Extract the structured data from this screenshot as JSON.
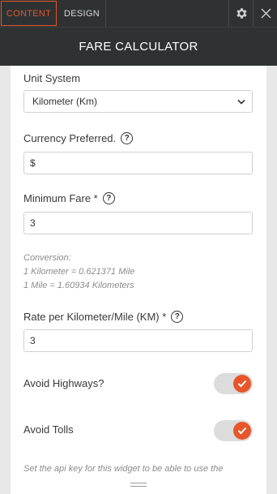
{
  "tabs": {
    "content": "CONTENT",
    "design": "DESIGN"
  },
  "header": {
    "title": "FARE CALCULATOR"
  },
  "form": {
    "unit_system": {
      "label": "Unit System",
      "value": "Kilometer (Km)"
    },
    "currency": {
      "label": "Currency Preferred.",
      "value": "$"
    },
    "minimum_fare": {
      "label": "Minimum Fare *",
      "value": "3"
    },
    "conversion": {
      "heading": "Conversion:",
      "line1": "1 Kilometer = 0.621371 Mile",
      "line2": "1 Mile = 1.60934 Kilometers"
    },
    "rate": {
      "label": "Rate per Kilometer/Mile (KM) *",
      "value": "3"
    },
    "avoid_highways": {
      "label": "Avoid Highways?",
      "on": true
    },
    "avoid_tolls": {
      "label": "Avoid Tolls",
      "on": true
    },
    "api_note": "Set the api key for this widget to be able to use the"
  },
  "help_glyph": "?",
  "icons": {
    "settings": "gear-icon",
    "close": "close-icon",
    "check": "check-icon",
    "dropdown": "chevron-down-icon",
    "resize": "drag-handle-icon"
  },
  "colors": {
    "accent": "#e8552b",
    "toolbar": "#2f3233"
  }
}
